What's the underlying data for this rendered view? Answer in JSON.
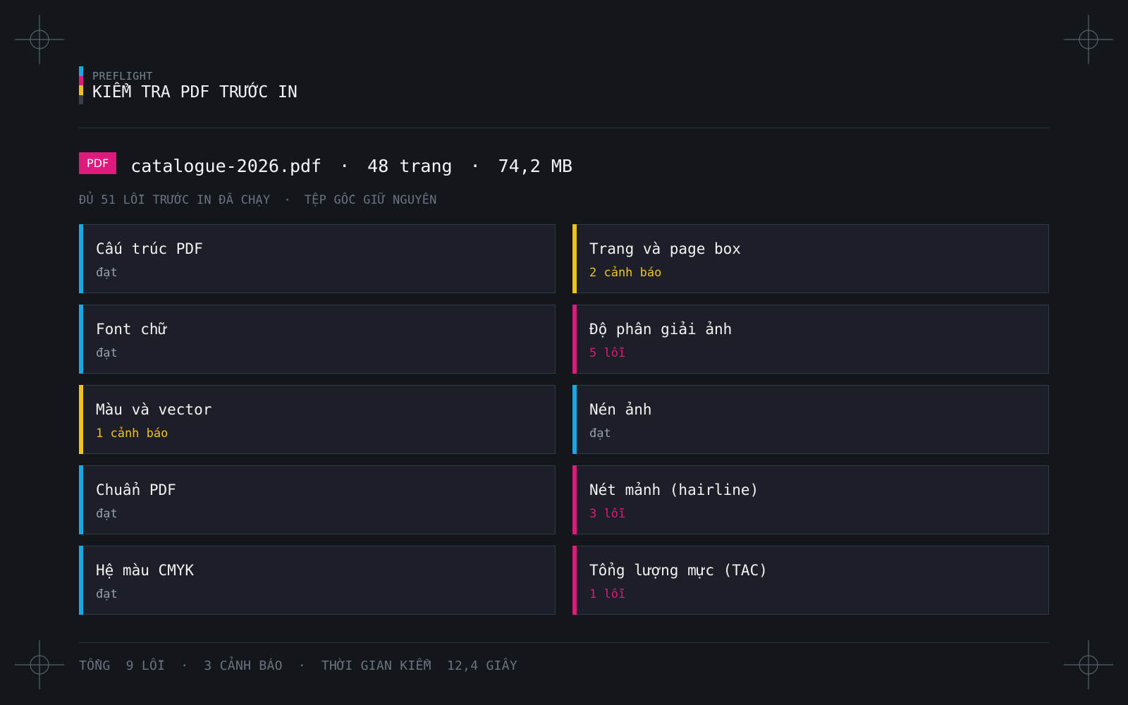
{
  "header": {
    "eyebrow": "PREFLIGHT",
    "title": "KIỂM TRA PDF TRƯỚC IN",
    "cmyk_colors": [
      "#1aa7e6",
      "#e0197d",
      "#f2c21b",
      "#3a3f49"
    ]
  },
  "file": {
    "badge": "PDF",
    "name": "catalogue-2026.pdf",
    "separator": "·",
    "pages": "48 trang",
    "size": "74,2 MB",
    "sub_left": "ĐỦ 51 LỖI TRƯỚC IN ĐÃ CHẠY",
    "sub_separator": "·",
    "sub_right": "TỆP GỐC GIỮ NGUYÊN"
  },
  "status_colors": {
    "ok": "#1aa7e6",
    "warning": "#f2c21b",
    "error": "#e0197d",
    "ok_text": "#9aa0ac"
  },
  "checks": [
    {
      "title": "Cấu trúc PDF",
      "status": "đạt",
      "level": "ok"
    },
    {
      "title": "Trang và page box",
      "status": "2 cảnh báo",
      "level": "warning"
    },
    {
      "title": "Font chữ",
      "status": "đạt",
      "level": "ok"
    },
    {
      "title": "Độ phân giải ảnh",
      "status": "5 lỗi",
      "level": "error"
    },
    {
      "title": "Màu và vector",
      "status": "1 cảnh báo",
      "level": "warning"
    },
    {
      "title": "Nén ảnh",
      "status": "đạt",
      "level": "ok"
    },
    {
      "title": "Chuẩn PDF",
      "status": "đạt",
      "level": "ok"
    },
    {
      "title": "Nét mảnh (hairline)",
      "status": "3 lỗi",
      "level": "error"
    },
    {
      "title": "Hệ màu CMYK",
      "status": "đạt",
      "level": "ok"
    },
    {
      "title": "Tổng lượng mực (TAC)",
      "status": "1 lỗi",
      "level": "error"
    }
  ],
  "footer": {
    "total_label": "TỔNG",
    "errors": "9 LỖI",
    "separator": "·",
    "warnings": "3 CẢNH BÁO",
    "time_label": "THỜI GIAN KIỂM",
    "time_value": "12,4 GIÂY"
  }
}
